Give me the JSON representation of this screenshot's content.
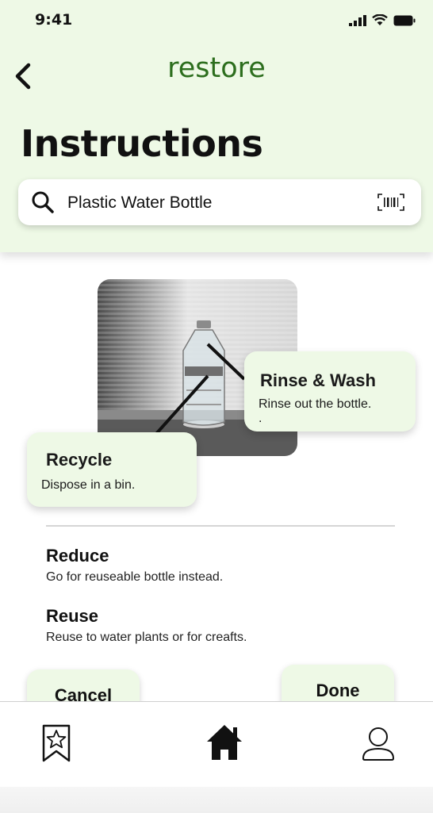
{
  "status_bar": {
    "time": "9:41",
    "icons": [
      "signal-icon",
      "wifi-icon",
      "battery-icon"
    ]
  },
  "header": {
    "app_title": "restore",
    "page_title": "Instructions",
    "back_icon": "chevron-left-icon"
  },
  "search": {
    "value": "Plastic Water Bottle",
    "icon": "search-icon",
    "scan_icon": "barcode-scan-icon"
  },
  "callouts": {
    "rinse": {
      "title": "Rinse & Wash",
      "desc": "Rinse out the bottle.",
      "extra": "."
    },
    "recycle": {
      "title": "Recycle",
      "desc": "Dispose in a bin."
    }
  },
  "tips": [
    {
      "title": "Reduce",
      "desc": "Go for reuseable bottle instead."
    },
    {
      "title": "Reuse",
      "desc": "Reuse to water plants or for creafts."
    }
  ],
  "actions": {
    "cancel": "Cancel",
    "done": "Done"
  },
  "tabbar": {
    "items": [
      "bookmark-star-icon",
      "home-icon",
      "profile-icon"
    ]
  },
  "colors": {
    "header_bg": "#eef9e6",
    "brand": "#2c6e1d",
    "card_bg": "#eef9e6"
  }
}
